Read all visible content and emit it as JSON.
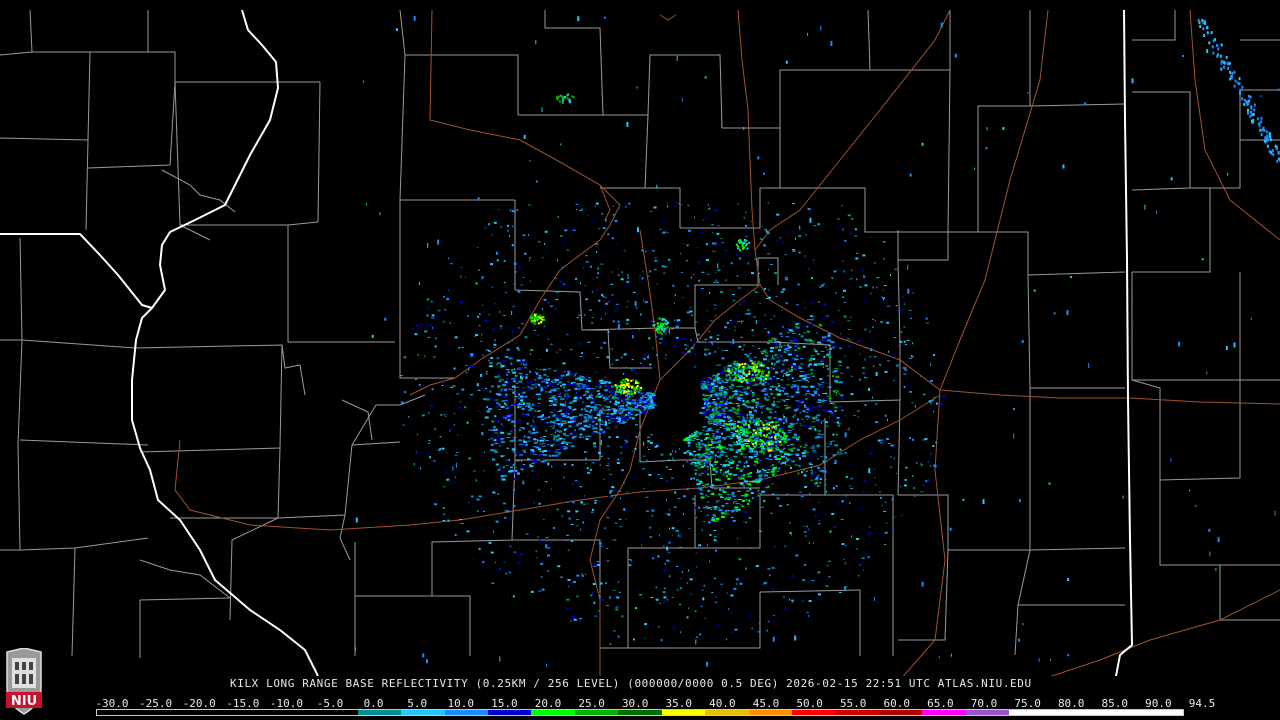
{
  "map": {
    "caption": "KILX LONG RANGE BASE REFLECTIVITY (0.25KM / 256 LEVEL) (000000/0000 0.5 DEG) 2026-02-15 22:51 UTC  ATLAS.NIU.EDU",
    "radar_site": "KILX",
    "product": "Long Range Base Reflectivity",
    "timestamp": "2026-02-15 22:51 UTC",
    "source": "ATLAS.NIU.EDU",
    "logo_text": "NIU"
  },
  "scale": {
    "labels": [
      "-30.0",
      "-25.0",
      "-20.0",
      "-15.0",
      "-10.0",
      "-5.0",
      "0.0",
      "5.0",
      "10.0",
      "15.0",
      "20.0",
      "25.0",
      "30.0",
      "35.0",
      "40.0",
      "45.0",
      "50.0",
      "55.0",
      "60.0",
      "65.0",
      "70.0",
      "75.0",
      "80.0",
      "85.0",
      "90.0",
      "94.5"
    ],
    "colors": [
      "#000000",
      "#000000",
      "#000000",
      "#000000",
      "#000000",
      "#000000",
      "#009090",
      "#22c8ff",
      "#1a8cff",
      "#0000d0",
      "#00ff00",
      "#00b000",
      "#007000",
      "#ffff00",
      "#e8c000",
      "#ff9000",
      "#ff0000",
      "#d00000",
      "#b00000",
      "#ff00ff",
      "#9955c9",
      "#ffffff",
      "#ffffff",
      "#ffffff",
      "#ffffff"
    ]
  },
  "colors": {
    "background": "#000000",
    "county_lines": "#9a9a9a",
    "state_lines": "#ffffff",
    "highways": "#a0522d"
  }
}
